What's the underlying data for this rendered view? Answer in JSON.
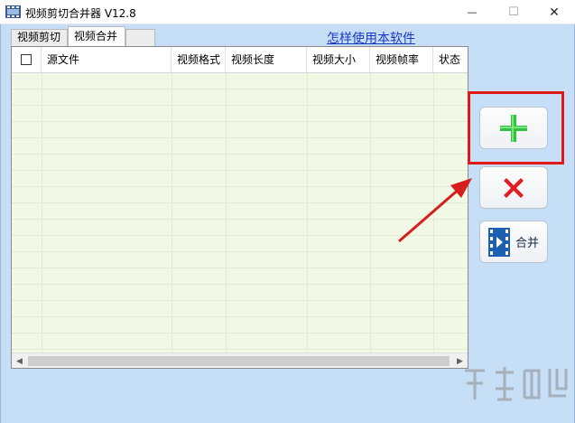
{
  "window": {
    "title": "视频剪切合并器 V12.8",
    "controls": {
      "minimize": "—",
      "maximize": "☐",
      "close": "✕"
    }
  },
  "tabs": [
    {
      "label": "视频剪切"
    },
    {
      "label": "视频合并"
    }
  ],
  "help_link": "怎样使用本软件",
  "table": {
    "columns": [
      "源文件",
      "视频格式",
      "视频长度",
      "视频大小",
      "视频帧率",
      "状态"
    ],
    "rows": []
  },
  "buttons": {
    "add": {
      "icon": "plus-icon",
      "color": "#2fbf3a"
    },
    "delete": {
      "icon": "red-x-icon",
      "color": "#e02020"
    },
    "merge": {
      "icon": "film-icon",
      "label": "合并"
    }
  },
  "scrollbar": {
    "left": "◀",
    "right": "▶"
  },
  "colors": {
    "table_body": "#f2f8e6",
    "background": "#c7dff6",
    "highlight": "#e01818",
    "link": "#1a38c8"
  }
}
